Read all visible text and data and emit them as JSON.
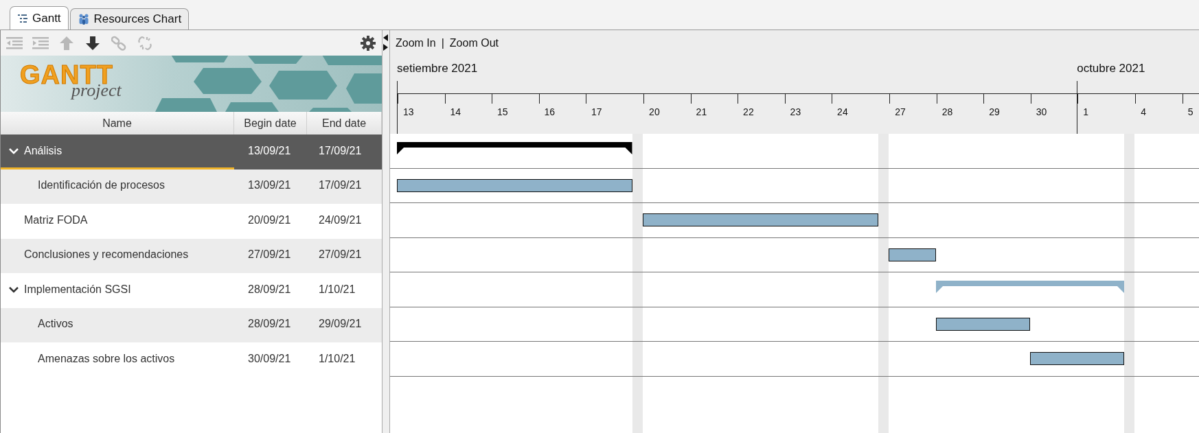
{
  "tabs": [
    {
      "label": "Gantt",
      "kind": "gantt",
      "selected": true
    },
    {
      "label": "Resources Chart",
      "kind": "resources",
      "selected": false
    }
  ],
  "toolbar": [
    {
      "kind": "outdent",
      "disabled": true
    },
    {
      "kind": "indent",
      "disabled": true
    },
    {
      "kind": "up",
      "disabled": true
    },
    {
      "kind": "down",
      "disabled": false
    },
    {
      "kind": "link",
      "disabled": true
    },
    {
      "kind": "unlink",
      "disabled": true
    }
  ],
  "logo": {
    "title": "GANTT",
    "subtitle": "project"
  },
  "columns": [
    "Name",
    "Begin date",
    "End date"
  ],
  "tasks": [
    {
      "name": "Análisis",
      "begin": "13/09/21",
      "end": "17/09/21",
      "kind": "summary",
      "expanded": true,
      "selected": true,
      "children": [
        {
          "name": "Identificación de procesos",
          "begin": "13/09/21",
          "end": "17/09/21",
          "kind": "task",
          "selected": false
        }
      ]
    },
    {
      "name": "Matriz FODA",
      "begin": "20/09/21",
      "end": "24/09/21",
      "kind": "task",
      "selected": false
    },
    {
      "name": "Conclusiones y recomendaciones",
      "begin": "27/09/21",
      "end": "27/09/21",
      "kind": "task",
      "selected": false
    },
    {
      "name": "Implementación SGSI",
      "begin": "28/09/21",
      "end": "1/10/21",
      "kind": "summary",
      "expanded": true,
      "selected": false,
      "children": [
        {
          "name": "Activos",
          "begin": "28/09/21",
          "end": "29/09/21",
          "kind": "task",
          "selected": false
        },
        {
          "name": "Amenazas sobre los activos",
          "begin": "30/09/21",
          "end": "1/10/21",
          "kind": "task",
          "selected": false
        }
      ]
    }
  ],
  "zoom": {
    "zoom_in": "Zoom In",
    "separator": "|",
    "zoom_out": "Zoom Out"
  },
  "days": [
    {
      "label": "13",
      "month": "setiembre 2021",
      "weekend_after": false
    },
    {
      "label": "14",
      "weekend_after": false
    },
    {
      "label": "15",
      "weekend_after": false
    },
    {
      "label": "16",
      "weekend_after": false
    },
    {
      "label": "17",
      "weekend_after": true
    },
    {
      "label": "20",
      "weekend_after": false
    },
    {
      "label": "21",
      "weekend_after": false
    },
    {
      "label": "22",
      "weekend_after": false
    },
    {
      "label": "23",
      "weekend_after": false
    },
    {
      "label": "24",
      "weekend_after": true
    },
    {
      "label": "27",
      "weekend_after": false
    },
    {
      "label": "28",
      "weekend_after": false
    },
    {
      "label": "29",
      "weekend_after": false
    },
    {
      "label": "30",
      "weekend_after": false
    },
    {
      "label": "1",
      "month": "octubre 2021",
      "weekend_after": true
    },
    {
      "label": "4",
      "weekend_after": false
    },
    {
      "label": "5",
      "weekend_after": false
    }
  ]
}
